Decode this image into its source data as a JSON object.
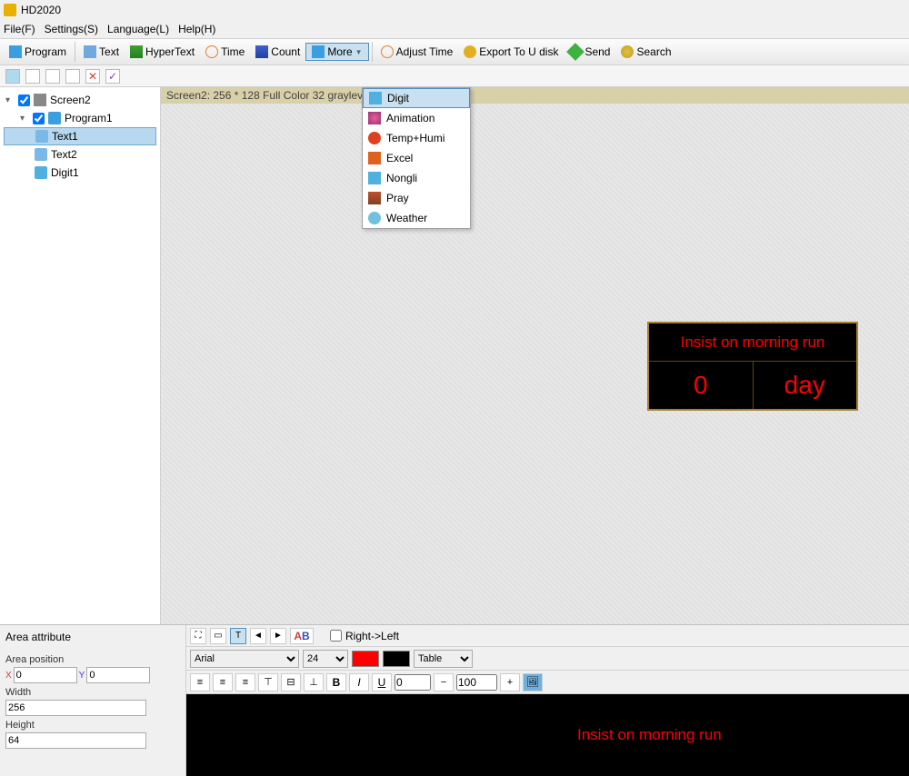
{
  "app": {
    "title": "HD2020"
  },
  "menubar": [
    "File(F)",
    "Settings(S)",
    "Language(L)",
    "Help(H)"
  ],
  "toolbar": {
    "program": "Program",
    "text": "Text",
    "hypertext": "HyperText",
    "time": "Time",
    "count": "Count",
    "more": "More",
    "adjust_time": "Adjust Time",
    "export": "Export To U disk",
    "send": "Send",
    "search": "Search"
  },
  "info_strip": "Screen2: 256 * 128 Full Color 32 grayleve",
  "tree": {
    "screen": "Screen2",
    "program": "Program1",
    "text1": "Text1",
    "text2": "Text2",
    "digit1": "Digit1"
  },
  "dropdown": {
    "items": [
      "Digit",
      "Animation",
      "Temp+Humi",
      "Excel",
      "Nongli",
      "Pray",
      "Weather"
    ]
  },
  "panel": {
    "title": "Insist on morning run",
    "num": "0",
    "unit": "day"
  },
  "attr": {
    "header": "Area attribute",
    "pos_label": "Area position",
    "x_label": "X",
    "x_val": "0",
    "y_label": "Y",
    "y_val": "0",
    "width_label": "Width",
    "width_val": "256",
    "height_label": "Height",
    "height_val": "64"
  },
  "editor": {
    "rtl_label": "Right->Left",
    "font": "Arial",
    "size": "24",
    "fg_color": "#ff0000",
    "bg_color": "#000000",
    "table": "Table",
    "spacing": "0",
    "zoom": "100",
    "preview_text": "Insist on morning run"
  }
}
